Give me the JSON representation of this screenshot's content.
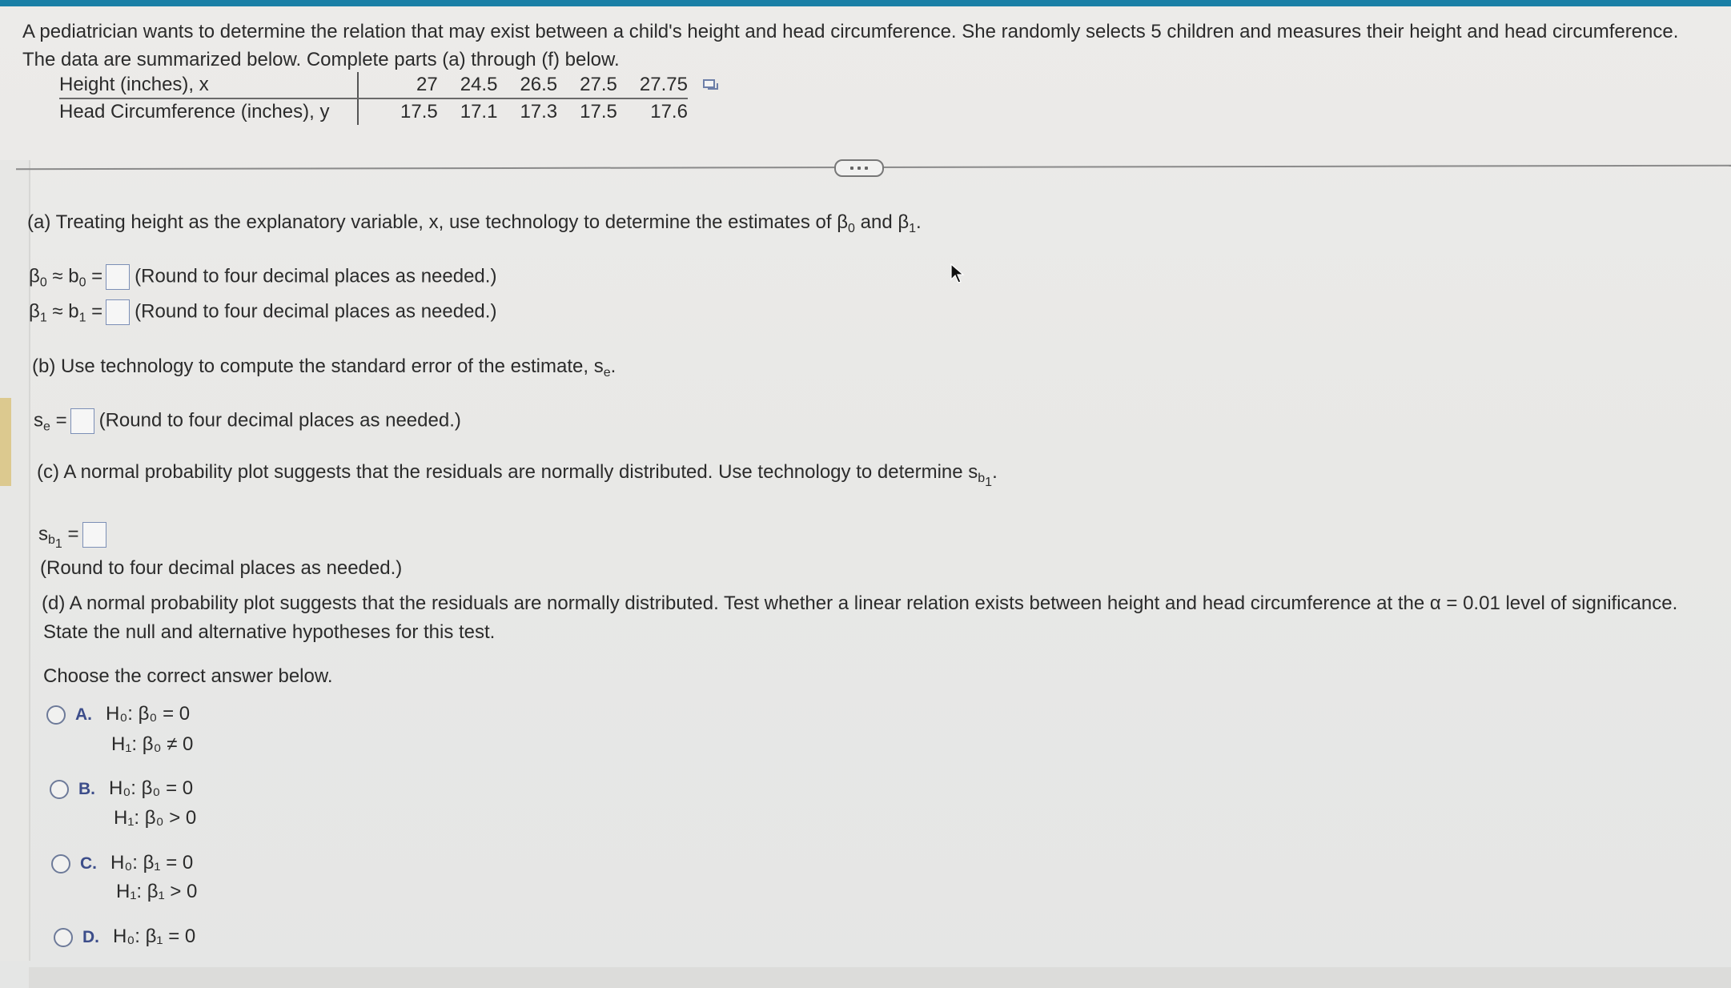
{
  "intro": {
    "line1": "A pediatrician wants to determine the relation that may exist between a child's height and head circumference. She randomly selects 5 children and measures their height and head circumference.",
    "line2": "The data are summarized below. Complete parts (a) through (f) below."
  },
  "table": {
    "row_x_label": "Height (inches), x",
    "row_y_label": "Head Circumference (inches), y",
    "x_values": [
      "27",
      "24.5",
      "26.5",
      "27.5",
      "27.75"
    ],
    "y_values": [
      "17.5",
      "17.1",
      "17.3",
      "17.5",
      "17.6"
    ]
  },
  "more_button": "...",
  "part_a": {
    "prompt": "(a) Treating height as the explanatory variable, x, use technology to determine the estimates of β",
    "prompt_sub0": "0",
    "prompt_and": " and β",
    "prompt_sub1": "1",
    "prompt_end": ".",
    "b0_prefix": "β",
    "b0_sub": "0",
    "b0_approx": " ≈ b",
    "b0_sub2": "0",
    "b0_eq": " =",
    "b0_value": "",
    "b0_hint": "(Round to four decimal places as needed.)",
    "b1_prefix": "β",
    "b1_sub": "1",
    "b1_approx": " ≈ b",
    "b1_sub2": "1",
    "b1_eq": " =",
    "b1_value": "",
    "b1_hint": "(Round to four decimal places as needed.)"
  },
  "part_b": {
    "prompt": "(b) Use technology to compute the standard error of the estimate, s",
    "prompt_sub": "e",
    "prompt_end": ".",
    "se_label": "s",
    "se_sub": "e",
    "se_eq": " =",
    "se_value": "",
    "se_hint": "(Round to four decimal places as needed.)"
  },
  "part_c": {
    "prompt": "(c) A normal probability plot suggests that the residuals are normally distributed. Use  technology to determine s",
    "prompt_sub": "b",
    "prompt_subsub": "1",
    "prompt_end": ".",
    "sb1_label": "s",
    "sb1_sub": "b",
    "sb1_subsub": "1",
    "sb1_eq": " =",
    "sb1_value": "",
    "sb1_hint": "(Round to four decimal places as needed.)"
  },
  "part_d": {
    "prompt_line1": "(d) A normal probability plot suggests that the residuals are normally distributed. Test whether a linear relation exists between height and head circumference at the α = 0.01 level of significance.",
    "prompt_line2": "State the null and alternative hypotheses for this test.",
    "choose": "Choose the correct answer below.",
    "options": [
      {
        "letter": "A.",
        "h0": "H₀: β₀ = 0",
        "h1": "H₁: β₀ ≠ 0"
      },
      {
        "letter": "B.",
        "h0": "H₀: β₀ = 0",
        "h1": "H₁: β₀ > 0"
      },
      {
        "letter": "C.",
        "h0": "H₀: β₁ = 0",
        "h1": "H₁: β₁ > 0"
      },
      {
        "letter": "D.",
        "h0": "H₀: β₁ = 0",
        "h1": ""
      }
    ]
  },
  "colors": {
    "topbar": "#1a7fa6",
    "option_letter": "#3c4d8a",
    "radio_border": "#6d7a99",
    "answer_box_border": "#7c8fb6",
    "left_strip": "#dcc98f"
  }
}
